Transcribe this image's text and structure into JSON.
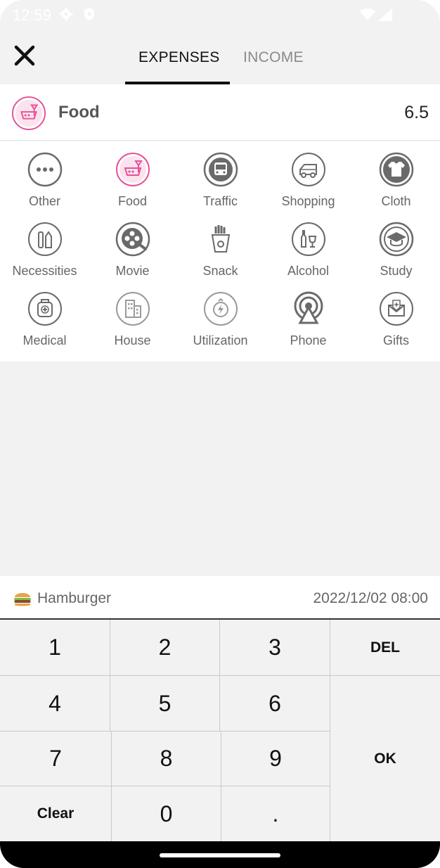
{
  "status_bar": {
    "time": "12:59"
  },
  "header": {
    "tabs": [
      {
        "label": "EXPENSES",
        "active": true
      },
      {
        "label": "INCOME",
        "active": false
      }
    ]
  },
  "selected": {
    "name": "Food",
    "amount": "6.5",
    "icon": "food-icon"
  },
  "categories": [
    {
      "label": "Other",
      "icon": "more-dots-icon",
      "selected": false
    },
    {
      "label": "Food",
      "icon": "food-icon",
      "selected": true
    },
    {
      "label": "Traffic",
      "icon": "bus-icon",
      "selected": false
    },
    {
      "label": "Shopping",
      "icon": "shopping-cart-icon",
      "selected": false
    },
    {
      "label": "Cloth",
      "icon": "tshirt-icon",
      "selected": false
    },
    {
      "label": "Necessities",
      "icon": "toiletries-icon",
      "selected": false
    },
    {
      "label": "Movie",
      "icon": "film-reel-icon",
      "selected": false
    },
    {
      "label": "Snack",
      "icon": "fries-icon",
      "selected": false
    },
    {
      "label": "Alcohol",
      "icon": "wine-icon",
      "selected": false
    },
    {
      "label": "Study",
      "icon": "graduation-cap-icon",
      "selected": false
    },
    {
      "label": "Medical",
      "icon": "medicine-bottle-icon",
      "selected": false
    },
    {
      "label": "House",
      "icon": "building-icon",
      "selected": false
    },
    {
      "label": "Utilization",
      "icon": "lightning-icon",
      "selected": false
    },
    {
      "label": "Phone",
      "icon": "antenna-icon",
      "selected": false
    },
    {
      "label": "Gifts",
      "icon": "envelope-gift-icon",
      "selected": false
    }
  ],
  "note": {
    "text": "Hamburger",
    "date": "2022/12/02 08:00",
    "icon": "hamburger-icon"
  },
  "keypad": {
    "k1": "1",
    "k2": "2",
    "k3": "3",
    "del": "DEL",
    "k4": "4",
    "k5": "5",
    "k6": "6",
    "k7": "7",
    "k8": "8",
    "k9": "9",
    "ok": "OK",
    "clear": "Clear",
    "k0": "0",
    "dot": "."
  },
  "colors": {
    "accent": "#e5529a",
    "icon_gray": "#6a6a6a",
    "background": "#f2f2f2"
  }
}
